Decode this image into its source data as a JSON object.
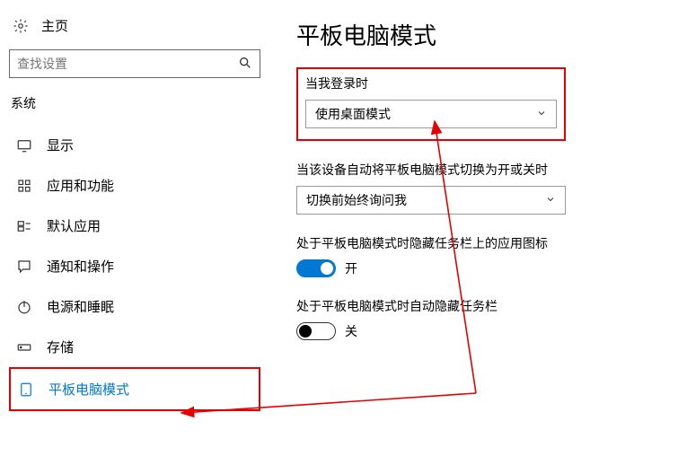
{
  "home": {
    "label": "主页"
  },
  "search": {
    "placeholder": "查找设置"
  },
  "group": {
    "label": "系统"
  },
  "nav": [
    {
      "label": "显示"
    },
    {
      "label": "应用和功能"
    },
    {
      "label": "默认应用"
    },
    {
      "label": "通知和操作"
    },
    {
      "label": "电源和睡眠"
    },
    {
      "label": "存储"
    },
    {
      "label": "平板电脑模式"
    }
  ],
  "page": {
    "title": "平板电脑模式"
  },
  "setting1": {
    "label": "当我登录时",
    "value": "使用桌面模式"
  },
  "setting2": {
    "label": "当该设备自动将平板电脑模式切换为开或关时",
    "value": "切换前始终询问我"
  },
  "setting3": {
    "label": "处于平板电脑模式时隐藏任务栏上的应用图标",
    "state": "开"
  },
  "setting4": {
    "label": "处于平板电脑模式时自动隐藏任务栏",
    "state": "关"
  }
}
